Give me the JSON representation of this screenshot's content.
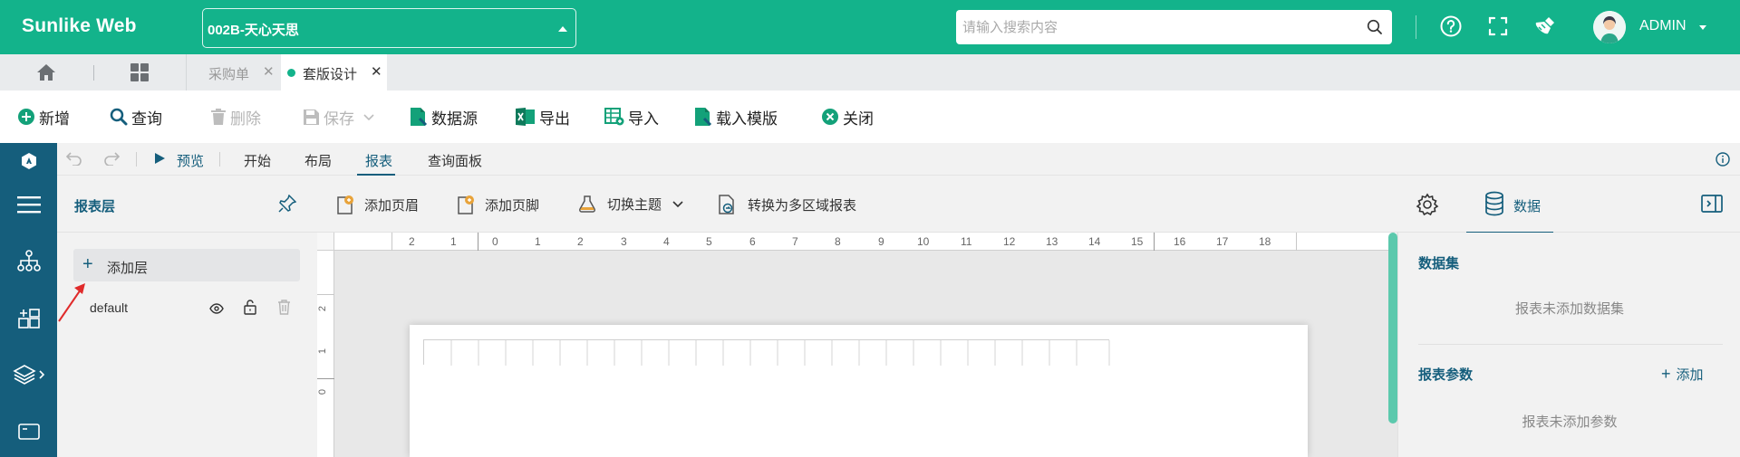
{
  "header": {
    "brand": "Sunlike Web",
    "account_selector": "002B-天心天思",
    "search_placeholder": "请输入搜索内容",
    "username": "ADMIN"
  },
  "tabs": {
    "home_icon": "home-icon",
    "apps_icon": "grid-icon",
    "items": [
      {
        "label": "采购单",
        "active": false
      },
      {
        "label": "套版设计",
        "active": true
      }
    ]
  },
  "toolbar": {
    "new": "新增",
    "query": "查询",
    "delete": "删除",
    "save": "保存",
    "datasource": "数据源",
    "export": "导出",
    "import": "导入",
    "load_template": "载入模版",
    "close": "关闭"
  },
  "designer": {
    "preview": "预览",
    "menu": [
      "开始",
      "布局",
      "报表",
      "查询面板"
    ],
    "active_menu": "报表"
  },
  "layer_header": {
    "title": "报表层",
    "add_header": "添加页眉",
    "add_footer": "添加页脚",
    "switch_theme": "切换主题",
    "convert": "转换为多区域报表",
    "data_tab": "数据"
  },
  "layers": {
    "add_label": "添加层",
    "items": [
      {
        "name": "default"
      }
    ]
  },
  "ruler": {
    "h_labels": [
      "2",
      "1",
      "0",
      "1",
      "2",
      "3",
      "4",
      "5",
      "6",
      "7",
      "8",
      "9",
      "10",
      "11",
      "12",
      "13",
      "14",
      "15",
      "16",
      "17",
      "18"
    ],
    "v_labels": [
      "2",
      "1",
      "0"
    ]
  },
  "data_panel": {
    "dataset_title": "数据集",
    "dataset_empty": "报表未添加数据集",
    "params_title": "报表参数",
    "params_add": "添加",
    "params_empty": "报表未添加参数"
  },
  "colors": {
    "brand_green": "#13b38b",
    "sidebar_blue": "#155e7c"
  }
}
